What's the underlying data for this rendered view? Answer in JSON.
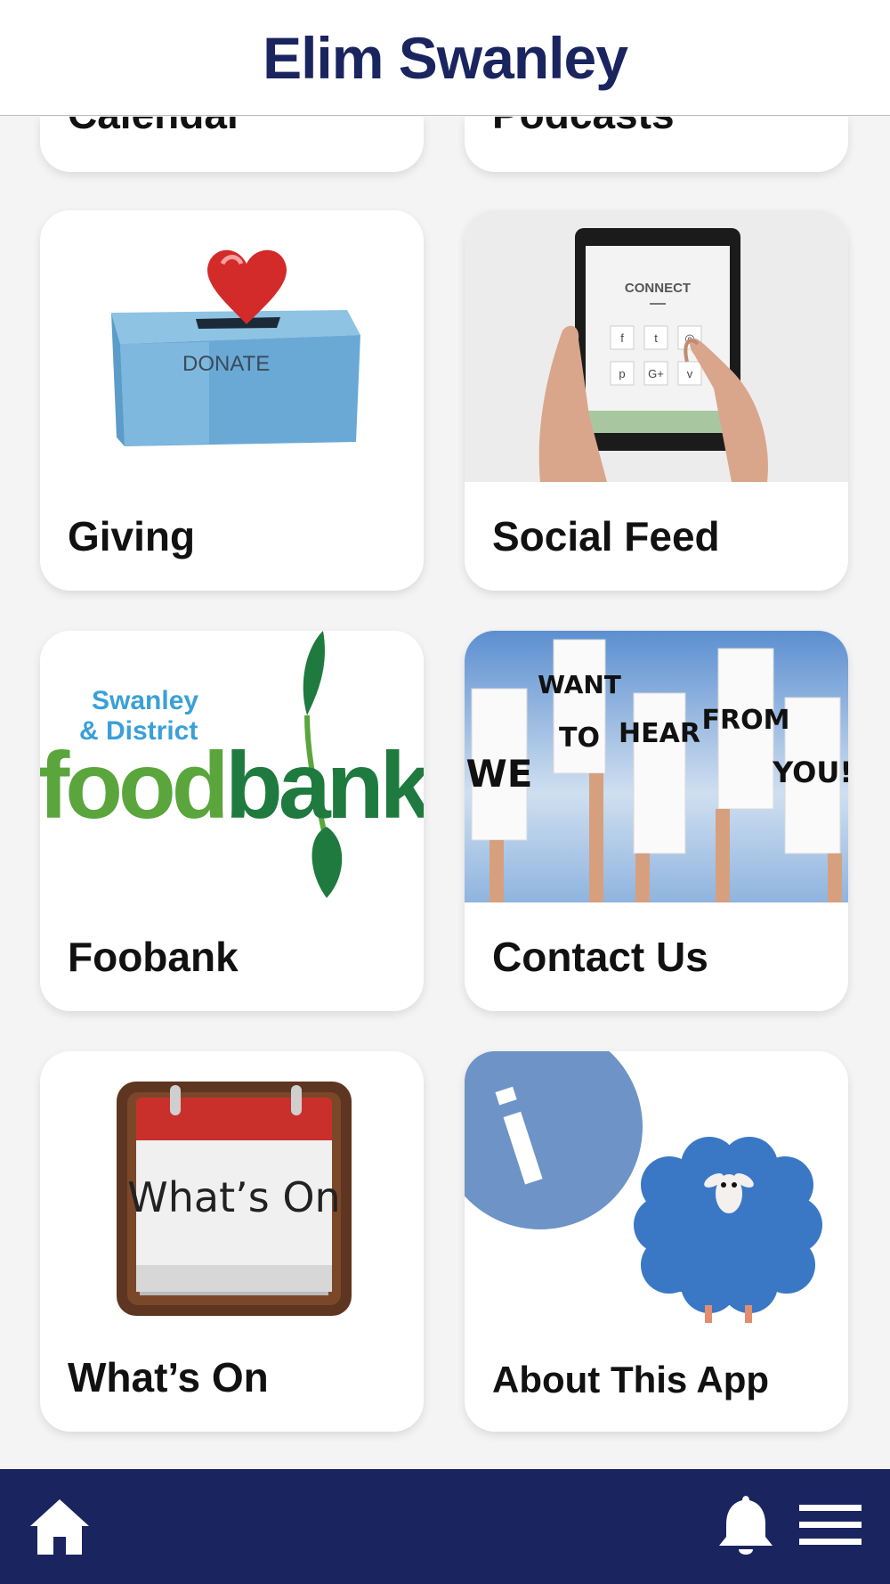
{
  "header": {
    "title": "Elim Swanley"
  },
  "tiles": {
    "calendar": {
      "label": "Calendar"
    },
    "podcasts": {
      "label": "Podcasts"
    },
    "giving": {
      "label": "Giving",
      "image_text": "DONATE"
    },
    "social_feed": {
      "label": "Social Feed",
      "image_text": "CONNECT",
      "social_icons": [
        "f",
        "t",
        "◎",
        "p",
        "G+",
        "v"
      ]
    },
    "foodbank": {
      "label": "Foobank",
      "logo_line1": "Swanley",
      "logo_line2": "& District",
      "logo_word_a": "food",
      "logo_word_b": "bank"
    },
    "contact_us": {
      "label": "Contact Us",
      "signs": [
        "WE",
        "WANT",
        "TO",
        "HEAR",
        "FROM",
        "YOU!"
      ]
    },
    "whats_on": {
      "label": "What’s On",
      "image_text": "What’s On"
    },
    "about": {
      "label": "About This App",
      "image_glyph": "i"
    }
  },
  "bottom_nav": {
    "home_icon": "home-icon",
    "bell_icon": "bell-icon",
    "menu_icon": "hamburger-menu-icon"
  },
  "colors": {
    "brand_navy": "#1a2560",
    "foodbank_green": "#5aa53c",
    "foodbank_dark_green": "#1f7a3f",
    "about_blue": "#6e93c6"
  }
}
